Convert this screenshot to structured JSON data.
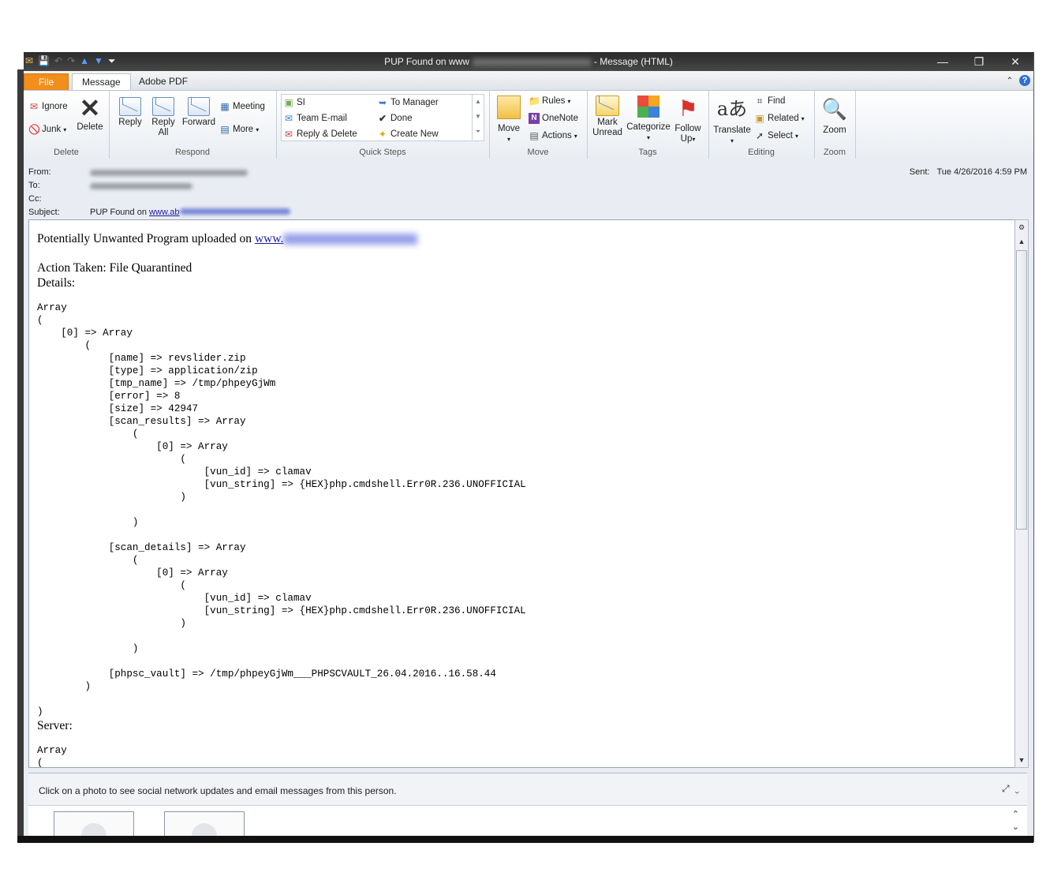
{
  "window": {
    "title_prefix": "PUP Found on www",
    "title_suffix": "- Message (HTML)",
    "controls": [
      "—",
      "❐",
      "✕"
    ]
  },
  "tabs": [
    "File",
    "Message",
    "Adobe PDF"
  ],
  "ribbon": {
    "delete_group": {
      "label": "Delete",
      "ignore": "Ignore",
      "junk": "Junk",
      "delete": "Delete"
    },
    "respond_group": {
      "label": "Respond",
      "reply": "Reply",
      "reply_all_1": "Reply",
      "reply_all_2": "All",
      "forward": "Forward",
      "meeting": "Meeting",
      "more": "More"
    },
    "quicksteps_group": {
      "label": "Quick Steps",
      "items": [
        "SI",
        "To Manager",
        "Team E-mail",
        "Done",
        "Reply & Delete",
        "Create New"
      ]
    },
    "move_group": {
      "label": "Move",
      "move": "Move",
      "rules": "Rules",
      "onenote": "OneNote",
      "actions": "Actions"
    },
    "tags_group": {
      "label": "Tags",
      "mark_unread_1": "Mark",
      "mark_unread_2": "Unread",
      "categorize": "Categorize",
      "follow_up_1": "Follow",
      "follow_up_2": "Up"
    },
    "editing_group": {
      "label": "Editing",
      "translate": "Translate",
      "find": "Find",
      "related": "Related",
      "select": "Select"
    },
    "zoom_group": {
      "label": "Zoom",
      "zoom": "Zoom"
    }
  },
  "header": {
    "from_label": "From:",
    "to_label": "To:",
    "cc_label": "Cc:",
    "subject_label": "Subject:",
    "subject_prefix": "PUP Found on",
    "subject_link": "www.ab",
    "sent_label": "Sent:",
    "sent_value": "Tue 4/26/2016 4:59 PM"
  },
  "body": {
    "line1_prefix": "Potentially Unwanted Program uploaded on",
    "line1_link": "www.",
    "action_taken": "Action Taken: File Quarantined",
    "details_label": "Details:",
    "dump": "Array\n(\n    [0] => Array\n        (\n            [name] => revslider.zip\n            [type] => application/zip\n            [tmp_name] => /tmp/phpeyGjWm\n            [error] => 8\n            [size] => 42947\n            [scan_results] => Array\n                (\n                    [0] => Array\n                        (\n                            [vun_id] => clamav\n                            [vun_string] => {HEX}php.cmdshell.Err0R.236.UNOFFICIAL\n                        )\n\n                )\n\n            [scan_details] => Array\n                (\n                    [0] => Array\n                        (\n                            [vun_id] => clamav\n                            [vun_string] => {HEX}php.cmdshell.Err0R.236.UNOFFICIAL\n                        )\n\n                )\n\n            [phpsc_vault] => /tmp/phpeyGjWm___PHPSCVAULT_26.04.2016..16.58.44\n        )\n\n)",
    "server_label": "Server:",
    "dump2": "Array\n("
  },
  "people_pane": {
    "hint": "Click on a photo to see social network updates and email messages from this person."
  },
  "colors": {
    "file_tab": "#f18e1c",
    "link": "#1a1a9e",
    "titlebar": "#333333"
  }
}
